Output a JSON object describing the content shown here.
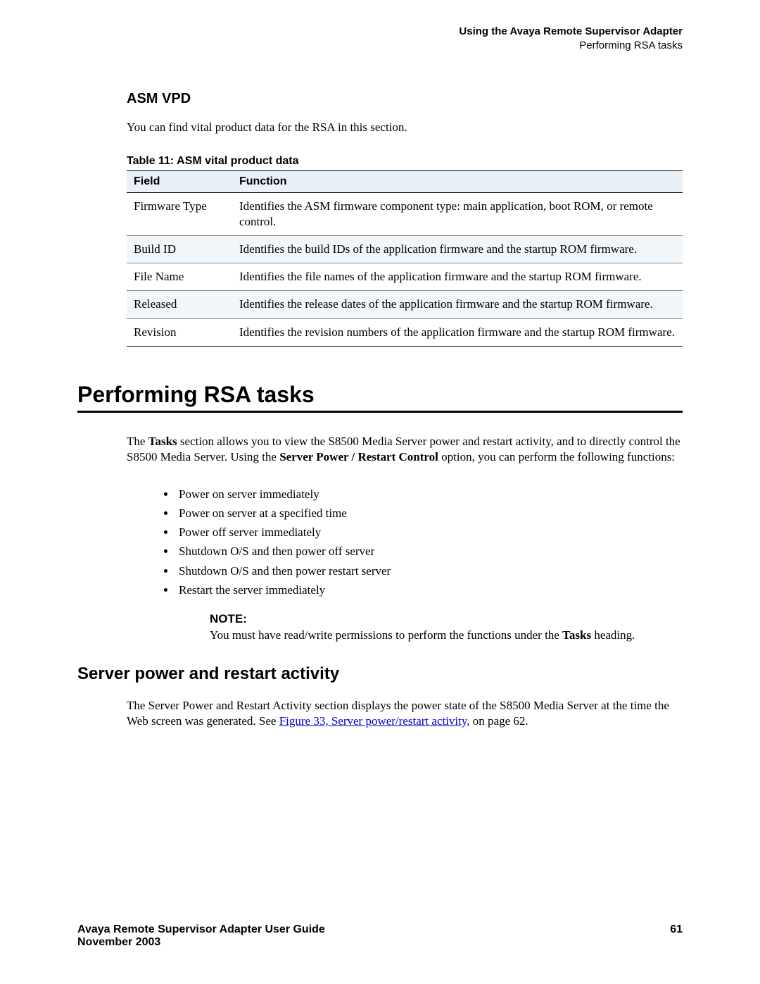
{
  "header": {
    "chapter": "Using the Avaya Remote Supervisor Adapter",
    "section": "Performing RSA tasks"
  },
  "asm_vpd": {
    "heading": "ASM VPD",
    "intro": "You can find vital product data for the RSA in this section.",
    "table_caption": "Table 11: ASM vital product data",
    "columns": {
      "field": "Field",
      "function": "Function"
    },
    "rows": [
      {
        "field": "Firmware Type",
        "function": "Identifies the ASM firmware component type: main application, boot ROM, or remote control."
      },
      {
        "field": "Build ID",
        "function": "Identifies the build IDs of the application firmware and the startup ROM firmware."
      },
      {
        "field": "File Name",
        "function": "Identifies the file names of the application firmware and the startup ROM firmware."
      },
      {
        "field": "Released",
        "function": "Identifies the release dates of the application firmware and the startup ROM firmware."
      },
      {
        "field": "Revision",
        "function": "Identifies the revision numbers of the application firmware and the startup ROM firmware."
      }
    ]
  },
  "rsa_tasks": {
    "heading": "Performing RSA tasks",
    "intro_parts": {
      "p1": "The ",
      "b1": "Tasks",
      "p2": " section allows you to view the S8500 Media Server power and restart activity, and to directly control the S8500 Media Server. Using the ",
      "b2": "Server Power / Restart Control",
      "p3": " option, you can perform the following functions:"
    },
    "bullets": [
      "Power on server immediately",
      "Power on server at a specified time",
      "Power off server immediately",
      "Shutdown O/S and then power off server",
      "Shutdown O/S and then power restart server",
      "Restart the server immediately"
    ],
    "note": {
      "label": "NOTE:",
      "text_pre": "You must have read/write permissions to perform the functions under the ",
      "text_bold": "Tasks",
      "text_post": " heading."
    }
  },
  "server_power": {
    "heading": "Server power and restart activity",
    "para_pre": "The Server Power and Restart Activity section displays the power state of the S8500 Media Server at the time the Web screen was generated. See ",
    "link_text": "Figure 33, Server power/restart activity,",
    "para_post": " on page 62."
  },
  "footer": {
    "title": "Avaya Remote Supervisor Adapter User Guide",
    "date": "November 2003",
    "page": "61"
  }
}
